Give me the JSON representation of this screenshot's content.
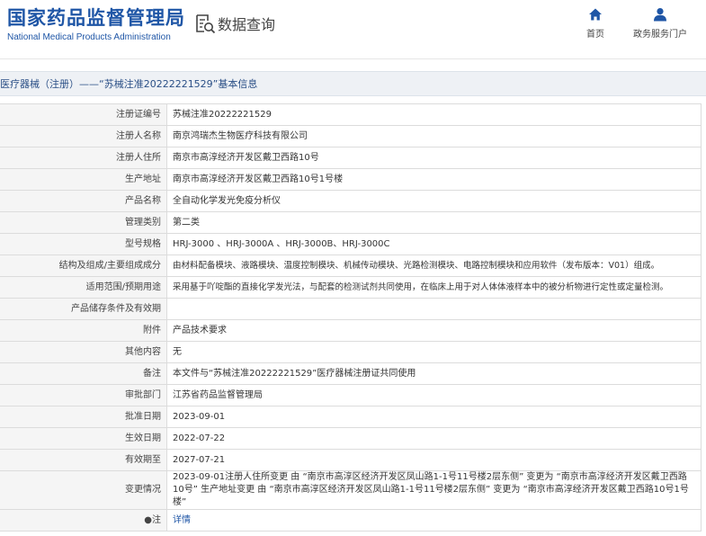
{
  "site": {
    "name_cn": "国家药品监督管理局",
    "name_en": "National Medical Products Administration"
  },
  "search_link": {
    "label": "数据查询",
    "icon": "search-data-icon"
  },
  "nav": [
    {
      "label": "首页",
      "icon": "home-icon"
    },
    {
      "label": "政务服务门户",
      "icon": "user-icon"
    }
  ],
  "page_title": "医疗器械（注册）——“苏械注准20222221529”基本信息",
  "colors": {
    "brand": "#1f56a6",
    "title_bg": "#eef1f5",
    "key_bg": "#f5f5f5"
  },
  "rows": [
    {
      "key": "注册证编号",
      "value": "苏械注准20222221529"
    },
    {
      "key": "注册人名称",
      "value": "南京鸿瑞杰生物医疗科技有限公司"
    },
    {
      "key": "注册人住所",
      "value": "南京市高淳经济开发区戴卫西路10号"
    },
    {
      "key": "生产地址",
      "value": "南京市高淳经济开发区戴卫西路10号1号楼"
    },
    {
      "key": "产品名称",
      "value": "全自动化学发光免疫分析仪"
    },
    {
      "key": "管理类别",
      "value": "第二类"
    },
    {
      "key": "型号规格",
      "value": "HRJ-3000 、HRJ-3000A 、HRJ-3000B、HRJ-3000C"
    },
    {
      "key": "结构及组成/主要组成成分",
      "value": "由材料配备模块、液路模块、温度控制模块、机械传动模块、光路检测模块、电路控制模块和应用软件（发布版本：V01）组成。"
    },
    {
      "key": "适用范围/预期用途",
      "value": "采用基于吖啶酯的直接化学发光法，与配套的检测试剂共同使用，在临床上用于对人体体液样本中的被分析物进行定性或定量检测。"
    },
    {
      "key": "产品储存条件及有效期",
      "value": ""
    },
    {
      "key": "附件",
      "value": "产品技术要求"
    },
    {
      "key": "其他内容",
      "value": "无"
    },
    {
      "key": "备注",
      "value": "本文件与“苏械注准20222221529”医疗器械注册证共同使用"
    },
    {
      "key": "审批部门",
      "value": "江苏省药品监督管理局"
    },
    {
      "key": "批准日期",
      "value": "2023-09-01"
    },
    {
      "key": "生效日期",
      "value": "2022-07-22"
    },
    {
      "key": "有效期至",
      "value": "2027-07-21"
    },
    {
      "key": "变更情况",
      "value": "2023-09-01注册人住所变更 由 “南京市高淳区经济开发区凤山路1-1号11号楼2层东侧” 变更为 “南京市高淳经济开发区戴卫西路10号” 生产地址变更 由 “南京市高淳区经济开发区凤山路1-1号11号楼2层东侧” 变更为 “南京市高淳经济开发区戴卫西路10号1号楼”"
    },
    {
      "key": "●注",
      "value": "详情"
    }
  ]
}
